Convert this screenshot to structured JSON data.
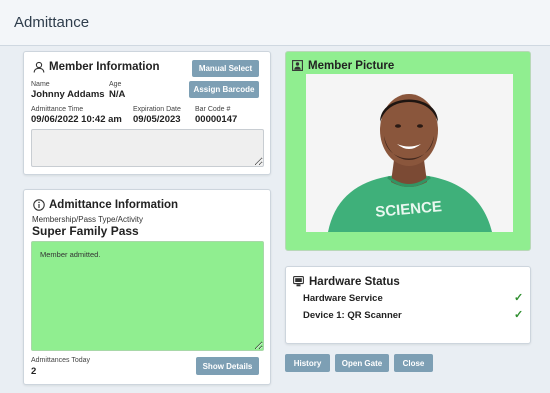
{
  "window": {
    "title": "Admittance"
  },
  "member_info": {
    "heading": "Member Information",
    "name_label": "Name",
    "name": "Johnny Addams",
    "age_label": "Age",
    "age": "N/A",
    "manual_select_label": "Manual Select",
    "assign_barcode_label": "Assign Barcode",
    "admittance_time_label": "Admittance Time",
    "admittance_time": "09/06/2022 10:42 am",
    "expiration_date_label": "Expiration Date",
    "expiration_date": "09/05/2023",
    "bar_code_label": "Bar Code #",
    "bar_code": "00000147",
    "notes": ""
  },
  "admittance_info": {
    "heading": "Admittance Information",
    "type_label": "Membership/Pass Type/Activity",
    "type_value": "Super Family Pass",
    "message": "Member admitted.",
    "admittances_today_label": "Admittances Today",
    "admittances_today": "2",
    "show_details_label": "Show Details"
  },
  "member_picture": {
    "heading": "Member Picture",
    "shirt_text": "SCIENCE"
  },
  "hardware_status": {
    "heading": "Hardware Status",
    "items": [
      {
        "label": "Hardware Service",
        "status": "ok"
      },
      {
        "label": "Device 1: QR Scanner",
        "status": "ok"
      }
    ]
  },
  "actions": {
    "history_label": "History",
    "open_gate_label": "Open Gate",
    "close_label": "Close"
  },
  "colors": {
    "accent_button": "#7d9fb4",
    "admitted_green": "#90ee90",
    "check_green": "#2f8f2f"
  }
}
